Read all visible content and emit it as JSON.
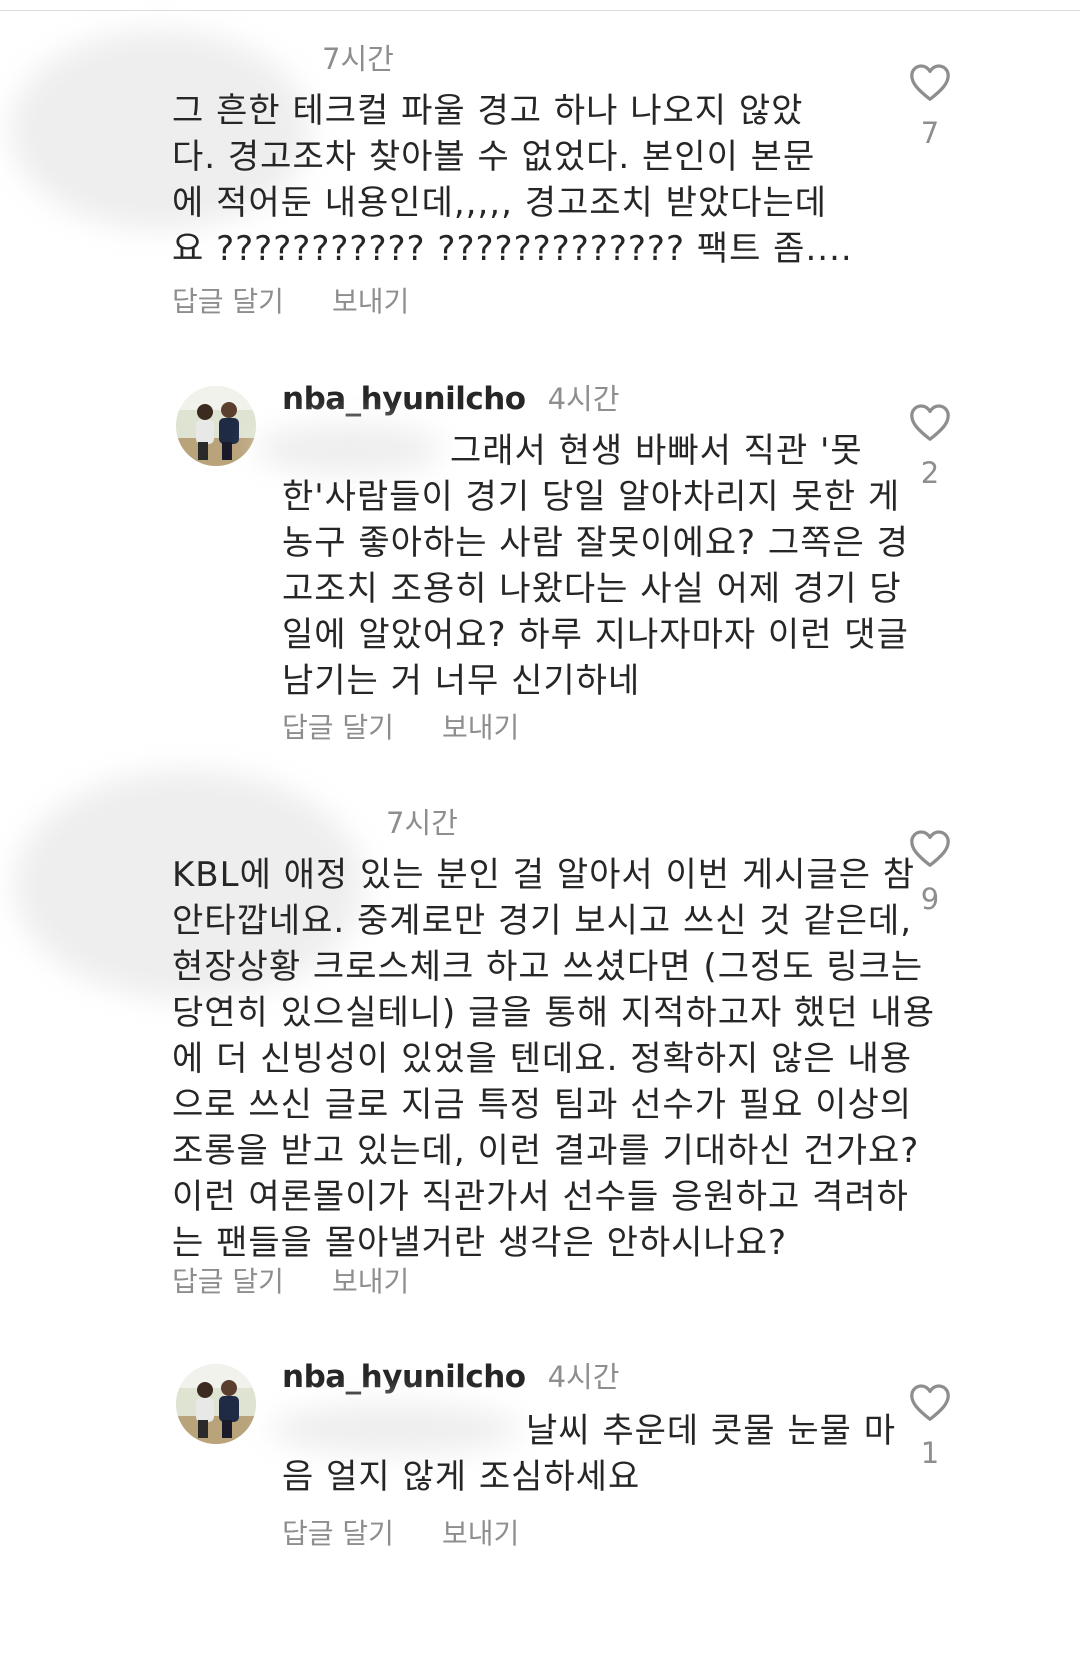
{
  "comments": [
    {
      "username": "",
      "time": "7시간",
      "lines": [
        "그 흔한 테크컬 파울 경고 하나 나오지 않았",
        "다. 경고조차 찾아볼 수 없었다. 본인이 본문",
        "에 적어둔 내용인데,,,,, 경고조치 받았다는데",
        "요 ??????????? ????????????? 팩트 좀...."
      ],
      "reply_label": "답글 달기",
      "send_label": "보내기",
      "likes": "7"
    },
    {
      "username": "nba_hyunilcho",
      "time": "4시간",
      "lines": [
        "그래서 현생 바빠서 직관 '못",
        "한'사람들이 경기 당일 알아차리지 못한 게",
        "농구 좋아하는 사람 잘못이에요? 그쪽은 경",
        "고조치 조용히 나왔다는 사실 어제 경기 당",
        "일에 알았어요? 하루 지나자마자 이런 댓글",
        "남기는 거 너무 신기하네"
      ],
      "reply_label": "답글 달기",
      "send_label": "보내기",
      "likes": "2"
    },
    {
      "username": "",
      "time": "7시간",
      "lines": [
        "KBL에 애정 있는 분인 걸 알아서 이번 게시글은 참",
        "안타깝네요. 중계로만 경기 보시고 쓰신 것 같은데,",
        "현장상황 크로스체크 하고 쓰셨다면 (그정도 링크는",
        "당연히 있으실테니) 글을 통해 지적하고자 했던 내용",
        "에 더 신빙성이 있었을 텐데요. 정확하지 않은 내용",
        "으로 쓰신 글로 지금 특정 팀과 선수가 필요 이상의",
        "조롱을 받고 있는데, 이런 결과를 기대하신 건가요?",
        "이런 여론몰이가 직관가서 선수들 응원하고 격려하",
        "는 팬들을 몰아낼거란 생각은 안하시나요?"
      ],
      "reply_label": "답글 달기",
      "send_label": "보내기",
      "likes": "9"
    },
    {
      "username": "nba_hyunilcho",
      "time": "4시간",
      "lines": [
        "날씨 추운데 콧물 눈물 마",
        "음 얼지 않게 조심하세요"
      ],
      "reply_label": "답글 달기",
      "send_label": "보내기",
      "likes": "1"
    }
  ],
  "icons": {
    "like": "heart-outline-icon",
    "avatar": "avatar-photo"
  },
  "colors": {
    "text": "#262626",
    "secondary": "#8e8e8e",
    "heart": "#8e8e8e"
  }
}
